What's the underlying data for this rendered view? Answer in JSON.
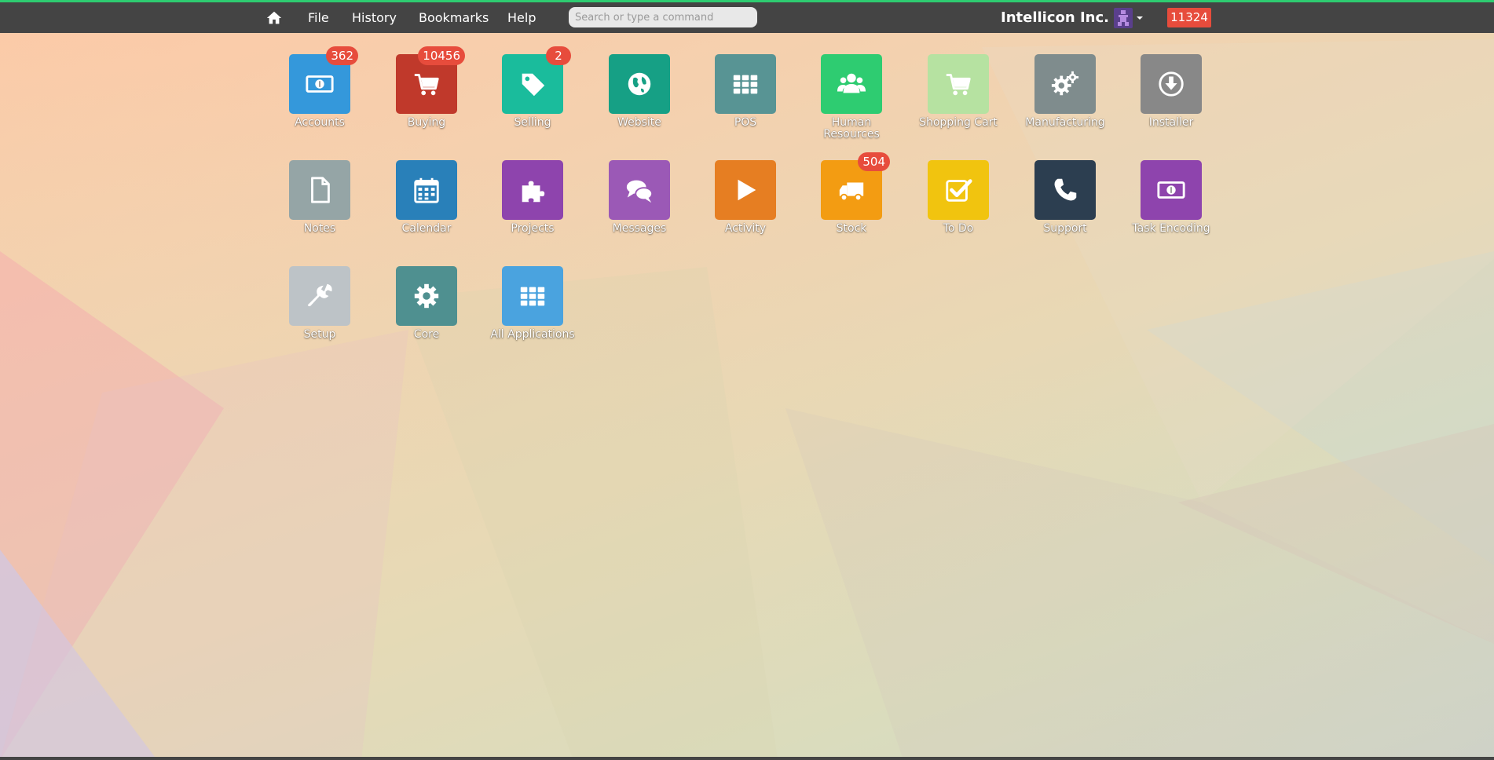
{
  "navbar": {
    "menus": [
      "File",
      "History",
      "Bookmarks",
      "Help"
    ],
    "search_placeholder": "Search or type a command",
    "brand": "Intellicon Inc.",
    "notification_count": "11324",
    "avatar_icon": "user-avatar-icon"
  },
  "apps": [
    {
      "label": "Accounts",
      "color": "#3498db",
      "icon": "money-icon",
      "badge": "362"
    },
    {
      "label": "Buying",
      "color": "#c0392b",
      "icon": "cart-icon",
      "badge": "10456"
    },
    {
      "label": "Selling",
      "color": "#1abc9c",
      "icon": "tag-icon",
      "badge": "2"
    },
    {
      "label": "Website",
      "color": "#16a085",
      "icon": "globe-icon",
      "badge": ""
    },
    {
      "label": "POS",
      "color": "#589494",
      "icon": "grid-icon",
      "badge": ""
    },
    {
      "label": "Human Resources",
      "color": "#2ecc71",
      "icon": "users-icon",
      "badge": ""
    },
    {
      "label": "Shopping Cart",
      "color": "#b6e2a1",
      "icon": "cart-icon",
      "badge": ""
    },
    {
      "label": "Manufacturing",
      "color": "#7f8c8d",
      "icon": "cogs-icon",
      "badge": ""
    },
    {
      "label": "Installer",
      "color": "#888888",
      "icon": "download-icon",
      "badge": ""
    },
    {
      "label": "Notes",
      "color": "#95a5a6",
      "icon": "file-icon",
      "badge": ""
    },
    {
      "label": "Calendar",
      "color": "#2980b9",
      "icon": "calendar-icon",
      "badge": ""
    },
    {
      "label": "Projects",
      "color": "#8e44ad",
      "icon": "puzzle-icon",
      "badge": ""
    },
    {
      "label": "Messages",
      "color": "#9b59b6",
      "icon": "comments-icon",
      "badge": ""
    },
    {
      "label": "Activity",
      "color": "#e67e22",
      "icon": "play-icon",
      "badge": ""
    },
    {
      "label": "Stock",
      "color": "#f39c12",
      "icon": "truck-icon",
      "badge": "504"
    },
    {
      "label": "To Do",
      "color": "#f1c40f",
      "icon": "check-icon",
      "badge": ""
    },
    {
      "label": "Support",
      "color": "#2c3e50",
      "icon": "phone-icon",
      "badge": ""
    },
    {
      "label": "Task Encoding",
      "color": "#8e44ad",
      "icon": "money-icon",
      "badge": ""
    },
    {
      "label": "Setup",
      "color": "#bdc3c7",
      "icon": "wrench-icon",
      "badge": ""
    },
    {
      "label": "Core",
      "color": "#4f9090",
      "icon": "gear-icon",
      "badge": ""
    },
    {
      "label": "All Applications",
      "color": "#4aa3df",
      "icon": "grid-icon",
      "badge": ""
    }
  ]
}
